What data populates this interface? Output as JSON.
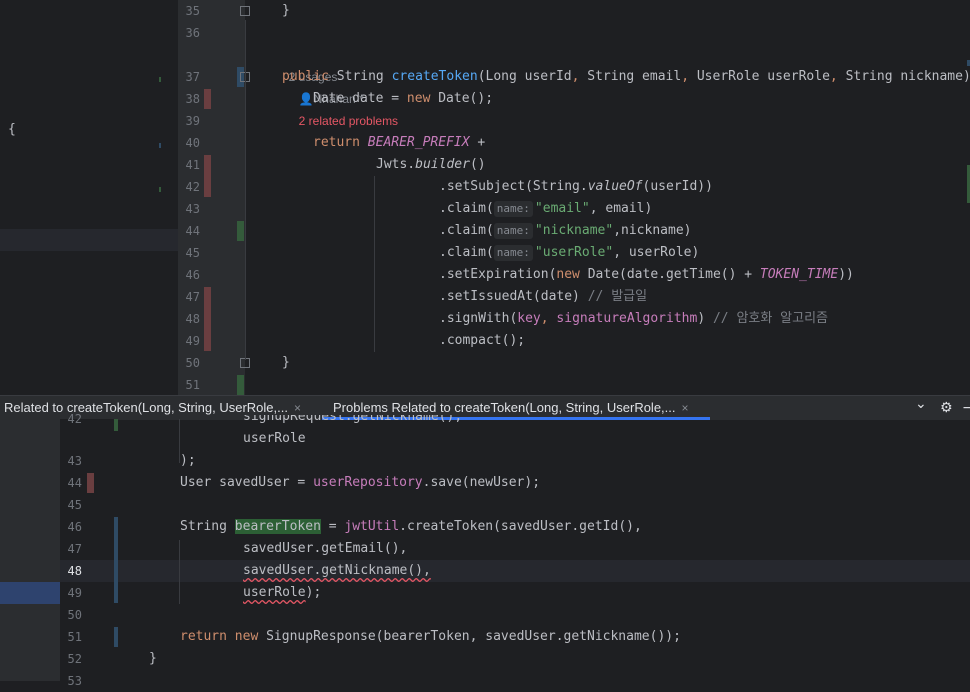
{
  "top_editor": {
    "line_numbers": [
      "35",
      "36",
      "37",
      "38",
      "39",
      "40",
      "41",
      "42",
      "43",
      "44",
      "45",
      "46",
      "47",
      "48",
      "49",
      "50",
      "51"
    ],
    "closing_brace": "}",
    "left_pane_brace": "{",
    "inlay": {
      "usages": "2 usages",
      "author": "Nhahan *",
      "problems": "2 related problems"
    },
    "lines": {
      "l37_public": "public ",
      "l37_type": "String ",
      "l37_name": "createToken",
      "l37_params1": "(Long userId",
      "l37_comma1": ", ",
      "l37_params2": "String email",
      "l37_comma2": ", ",
      "l37_params3": "UserRole userRole",
      "l37_comma3": ", ",
      "l37_params4": "String nickname)",
      "l38_a": "Date date = ",
      "l38_new": "new ",
      "l38_b": "Date();",
      "l40_return": "return ",
      "l40_const": "BEARER_PREFIX",
      "l40_plus": " +",
      "l41_a": "Jwts.",
      "l41_b": "builder",
      "l41_c": "()",
      "l42_a": ".setSubject(String.",
      "l42_b": "valueOf",
      "l42_c": "(userId))",
      "l43_a": ".claim(",
      "l43_hint": "name:",
      "l43_str": "\"email\"",
      "l43_b": ", email)",
      "l44_a": ".claim(",
      "l44_hint": "name:",
      "l44_str": "\"nickname\"",
      "l44_b": ",nickname)",
      "l45_a": ".claim(",
      "l45_hint": "name:",
      "l45_str": "\"userRole\"",
      "l45_b": ", userRole)",
      "l46_a": ".setExpiration(",
      "l46_new": "new ",
      "l46_b": "Date(date.getTime() + ",
      "l46_const": "TOKEN_TIME",
      "l46_c": "))",
      "l47_a": ".setIssuedAt(date) ",
      "l47_cmt": "// 발급일",
      "l48_a": ".signWith(",
      "l48_key": "key",
      "l48_comma": ", ",
      "l48_alg": "signatureAlgorithm",
      "l48_b": ") ",
      "l48_cmt": "// 암호화 알고리즘",
      "l49_a": ".compact();"
    }
  },
  "tabs": {
    "tab1_label": "Related to createToken(Long, String, UserRole,...",
    "tab2_label": "Problems Related to createToken(Long, String, UserRole,...",
    "close_glyph": "×",
    "chevron_glyph": "⌄",
    "gear_glyph": "⚙",
    "minus_glyph": "−"
  },
  "bottom_editor": {
    "line_numbers": [
      "42",
      "43",
      "44",
      "45",
      "46",
      "47",
      "48",
      "49",
      "50",
      "51",
      "52",
      "53"
    ],
    "lines": {
      "l41_partial": "signupRequest.getNickname(),",
      "l42": "userRole",
      "l43": ");",
      "l44_a": "User savedUser = ",
      "l44_field": "userRepository",
      "l44_b": ".save(newUser);",
      "l46_a": "String ",
      "l46_var": "bearerToken",
      "l46_b": " = ",
      "l46_field": "jwtUtil",
      "l46_c": ".createToken(savedUser.getId(),",
      "l47": "savedUser.getEmail(),",
      "l48_err": "savedUser.getNickname(),",
      "l49_err": "userRole",
      "l49_end": ");",
      "l51_return": "return ",
      "l51_new": "new ",
      "l51_b": "SignupResponse(bearerToken, savedUser.getNickname());",
      "l52": "}"
    }
  },
  "colors": {
    "background": "#1e1f22",
    "keyword": "#cf8e6d",
    "function": "#56a8f5",
    "string": "#6aab73",
    "field": "#c77dbb",
    "error": "#e55765",
    "accent": "#3574f0"
  }
}
